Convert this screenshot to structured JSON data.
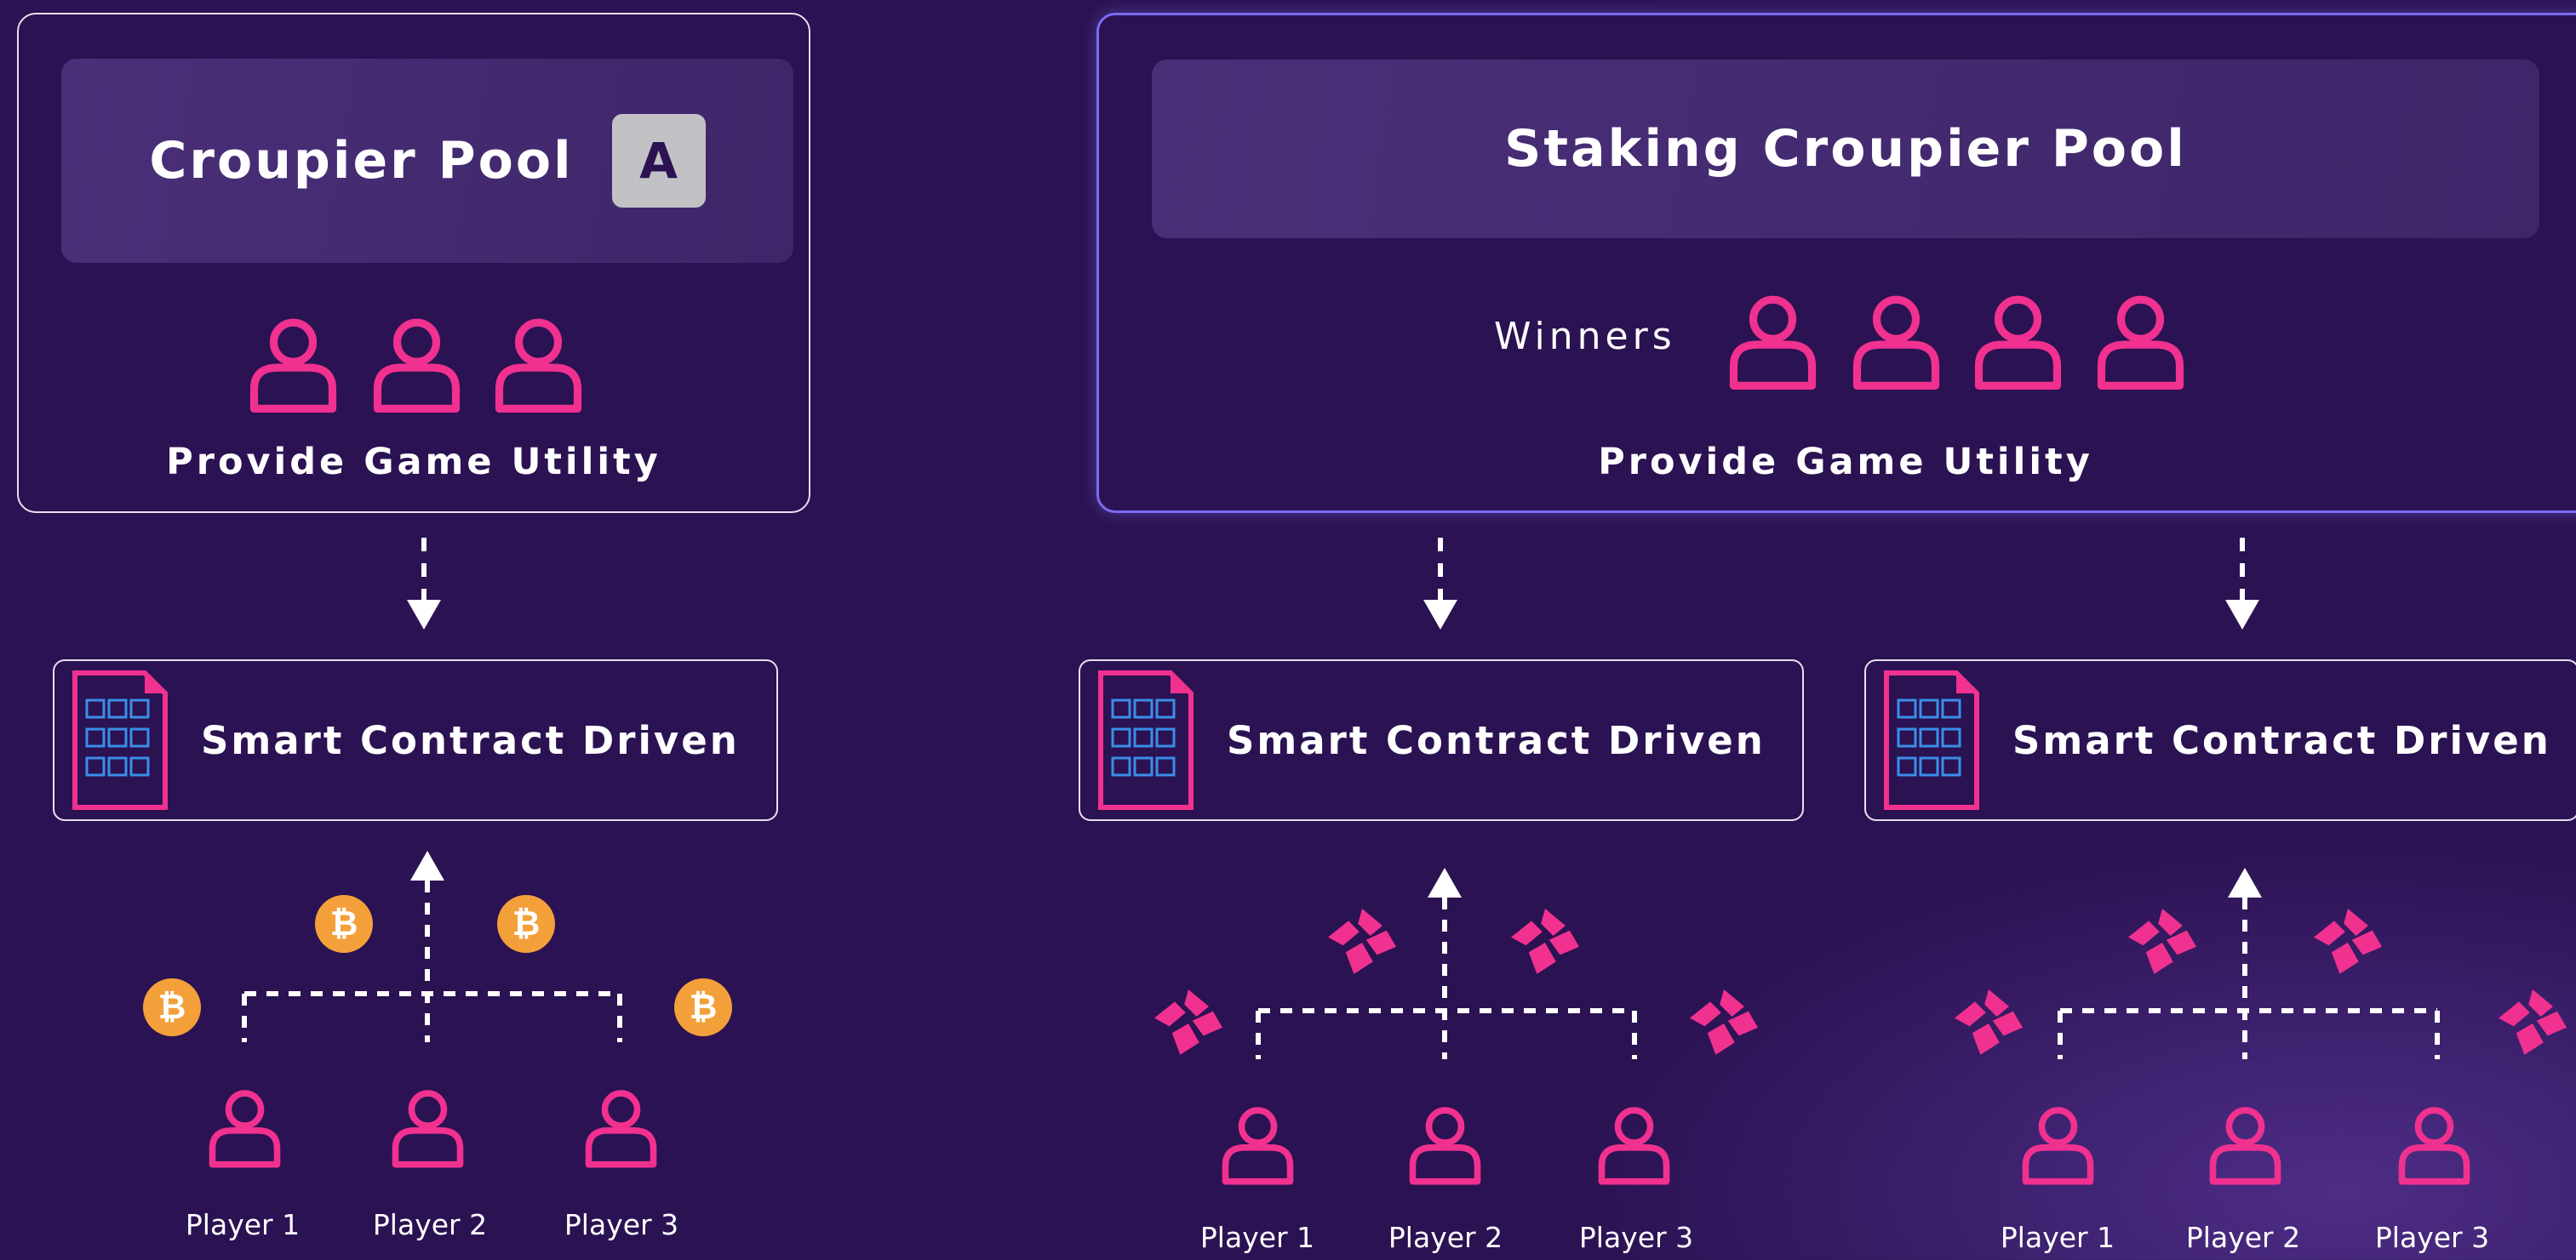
{
  "left": {
    "pool_title": "Croupier Pool",
    "badge": "A",
    "utility": "Provide Game Utility",
    "contract_label": "Smart Contract Driven",
    "players": [
      "Player 1",
      "Player 2",
      "Player 3"
    ],
    "token_icon": "bitcoin-coin-icon",
    "coin_symbol": "₿"
  },
  "right": {
    "pool_title": "Staking Croupier Pool",
    "winners_label": "Winners",
    "utility": "Provide Game Utility",
    "contracts": [
      {
        "label": "Smart Contract Driven",
        "players": [
          "Player 1",
          "Player 2",
          "Player 3"
        ]
      },
      {
        "label": "Smart Contract Driven",
        "players": [
          "Player 1",
          "Player 2",
          "Player 3"
        ]
      }
    ],
    "token_icon": "pink-token-icon"
  },
  "colors": {
    "background": "#2b1252",
    "accent_pink": "#f0318f",
    "coin_orange": "#f4a03a",
    "border_glow": "#7b6cf0"
  }
}
